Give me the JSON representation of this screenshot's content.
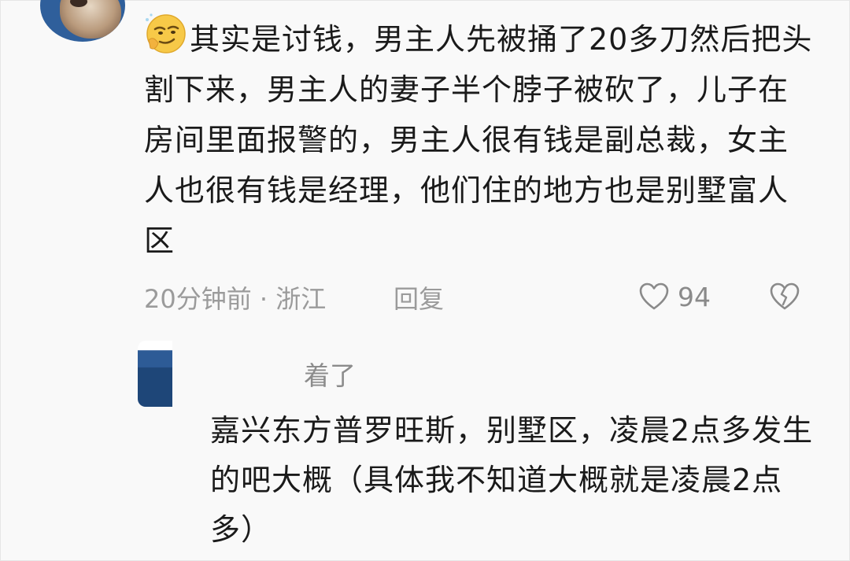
{
  "comment": {
    "text": "其实是讨钱，男主人先被捅了20多刀然后把头割下来，男主人的妻子半个脖子被砍了，儿子在房间里面报警的，男主人很有钱是副总裁，女主人也很有钱是经理，他们住的地方也是别墅富人区",
    "meta": "20分钟前 · 浙江",
    "reply_label": "回复",
    "like_count": "94",
    "emoji": "smirk-emoji-icon"
  },
  "reply": {
    "username": "着了",
    "text": "嘉兴东方普罗旺斯，别墅区，凌晨2点多发生的吧大概（具体我不知道大概就是凌晨2点多）"
  },
  "colors": {
    "background": "#f9f9f9",
    "text": "#1a1a1a",
    "meta": "#9b9b9b"
  }
}
